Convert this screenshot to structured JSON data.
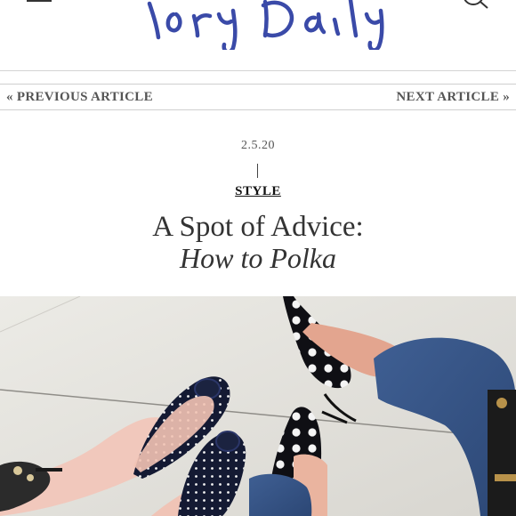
{
  "header": {
    "logo_text": "Tory Daily",
    "menu_icon": "hamburger-menu-icon",
    "search_icon": "search-icon"
  },
  "nav": {
    "previous_label": "« PREVIOUS ARTICLE",
    "next_label": "NEXT ARTICLE »"
  },
  "article": {
    "date": "2.5.20",
    "category": "STYLE",
    "title": "A Spot of Advice:",
    "subtitle": "How to Polka"
  },
  "colors": {
    "logo_blue": "#3a4aa8",
    "divider": "#d4d4d4",
    "nav_text": "#555555"
  }
}
